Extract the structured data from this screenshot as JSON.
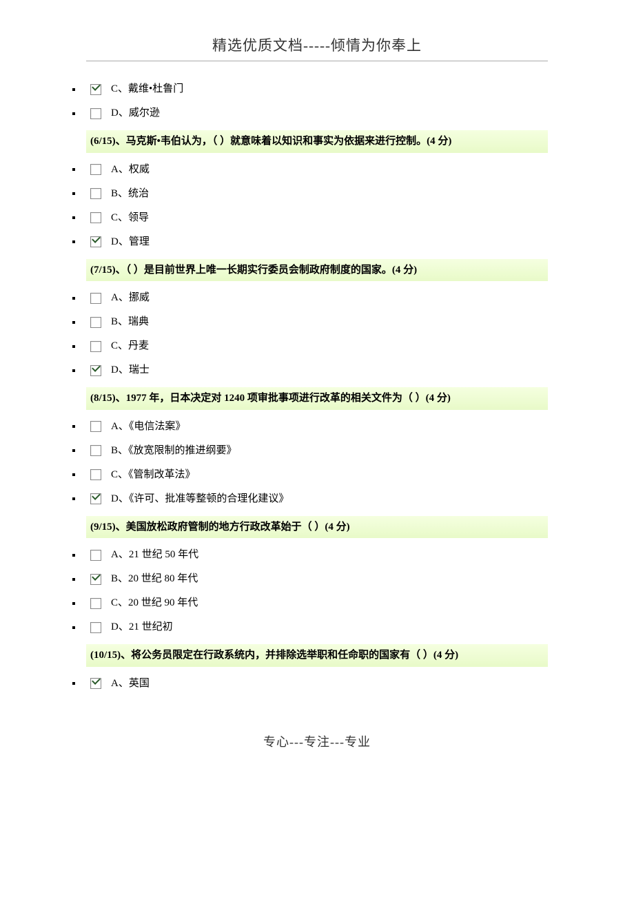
{
  "header": {
    "title": "精选优质文档-----倾情为你奉上"
  },
  "footer": {
    "text": "专心---专注---专业"
  },
  "blocks": [
    {
      "type": "option",
      "checked": true,
      "label": "C、戴维•杜鲁门"
    },
    {
      "type": "option",
      "checked": false,
      "label": "D、威尔逊"
    },
    {
      "type": "question",
      "text": "(6/15)、马克斯•韦伯认为，（ ）就意味着以知识和事实为依据来进行控制。(4 分)"
    },
    {
      "type": "option",
      "checked": false,
      "label": "A、权威"
    },
    {
      "type": "option",
      "checked": false,
      "label": "B、统治"
    },
    {
      "type": "option",
      "checked": false,
      "label": "C、领导"
    },
    {
      "type": "option",
      "checked": true,
      "label": "D、管理"
    },
    {
      "type": "question",
      "text": "(7/15)、（ ）是目前世界上唯一长期实行委员会制政府制度的国家。(4 分)"
    },
    {
      "type": "option",
      "checked": false,
      "label": "A、挪威"
    },
    {
      "type": "option",
      "checked": false,
      "label": "B、瑞典"
    },
    {
      "type": "option",
      "checked": false,
      "label": "C、丹麦"
    },
    {
      "type": "option",
      "checked": true,
      "label": "D、瑞士"
    },
    {
      "type": "question",
      "text": "(8/15)、1977 年，日本决定对 1240 项审批事项进行改革的相关文件为（ ）(4 分)"
    },
    {
      "type": "option",
      "checked": false,
      "label": "A、《电信法案》"
    },
    {
      "type": "option",
      "checked": false,
      "label": "B、《放宽限制的推进纲要》"
    },
    {
      "type": "option",
      "checked": false,
      "label": "C、《管制改革法》"
    },
    {
      "type": "option",
      "checked": true,
      "label": "D、《许可、批准等整顿的合理化建议》"
    },
    {
      "type": "question",
      "text": "(9/15)、美国放松政府管制的地方行政改革始于（ ）(4 分)"
    },
    {
      "type": "option",
      "checked": false,
      "label": "A、21 世纪 50 年代"
    },
    {
      "type": "option",
      "checked": true,
      "label": "B、20 世纪 80 年代"
    },
    {
      "type": "option",
      "checked": false,
      "label": "C、20 世纪 90 年代"
    },
    {
      "type": "option",
      "checked": false,
      "label": "D、21 世纪初"
    },
    {
      "type": "question",
      "text": "(10/15)、将公务员限定在行政系统内，并排除选举职和任命职的国家有（ ）(4 分)"
    },
    {
      "type": "option",
      "checked": true,
      "label": "A、英国"
    }
  ]
}
